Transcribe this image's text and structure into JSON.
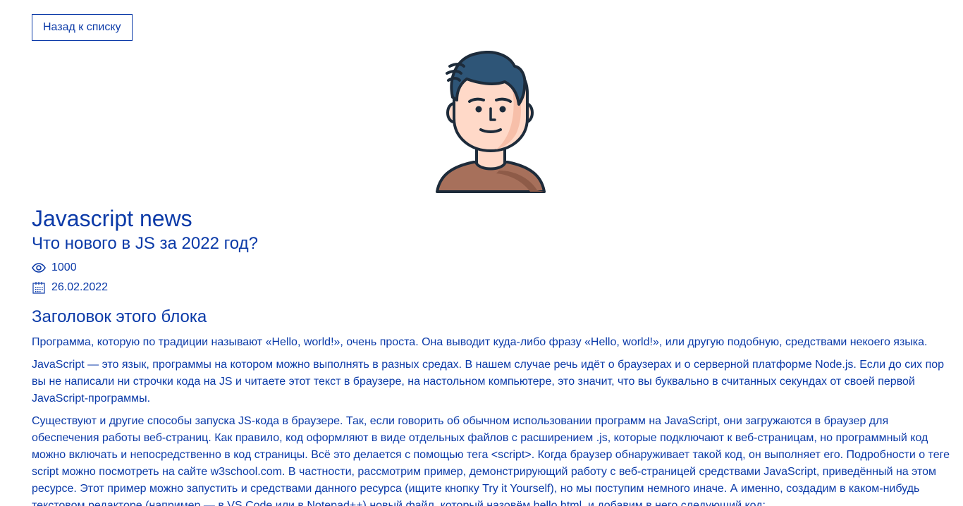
{
  "nav": {
    "back_label": "Назад к списку"
  },
  "article": {
    "title": "Javascript news",
    "subtitle": "Что нового в JS за 2022 год?",
    "views": "1000",
    "date": "26.02.2022",
    "block_title": "Заголовок этого блока",
    "paragraphs": [
      "Программа, которую по традиции называют «Hello, world!», очень проста. Она выводит куда-либо фразу «Hello, world!», или другую подобную, средствами некоего языка.",
      "JavaScript — это язык, программы на котором можно выполнять в разных средах. В нашем случае речь идёт о браузерах и о серверной платформе Node.js. Если до сих пор вы не написали ни строчки кода на JS и читаете этот текст в браузере, на настольном компьютере, это значит, что вы буквально в считанных секундах от своей первой JavaScript-программы.",
      "Существуют и другие способы запуска JS-кода в браузере. Так, если говорить об обычном использовании программ на JavaScript, они загружаются в браузер для обеспечения работы веб-страниц. Как правило, код оформляют в виде отдельных файлов с расширением .js, которые подключают к веб-страницам, но программный код можно включать и непосредственно в код страницы. Всё это делается с помощью тега <script>. Когда браузер обнаруживает такой код, он выполняет его. Подробности о теге script можно посмотреть на сайте w3school.com. В частности, рассмотрим пример, демонстрирующий работу с веб-страницей средствами JavaScript, приведённый на этом ресурсе. Этот пример можно запустить и средствами данного ресурса (ищите кнопку Try it Yourself), но мы поступим немного иначе. А именно, создадим в каком-нибудь текстовом редакторе (например — в VS Code или в Notepad++) новый файл, который назовём hello.html, и добавим в него следующий код:"
    ]
  },
  "icons": {
    "views": "eye-icon",
    "date": "calendar-icon",
    "avatar": "user-avatar-illustration"
  },
  "colors": {
    "accent": "#0b3aa8",
    "hair": "#2e5577",
    "skin": "#ffd9c8",
    "shirt": "#a7705b",
    "outline": "#1d2b3a"
  }
}
